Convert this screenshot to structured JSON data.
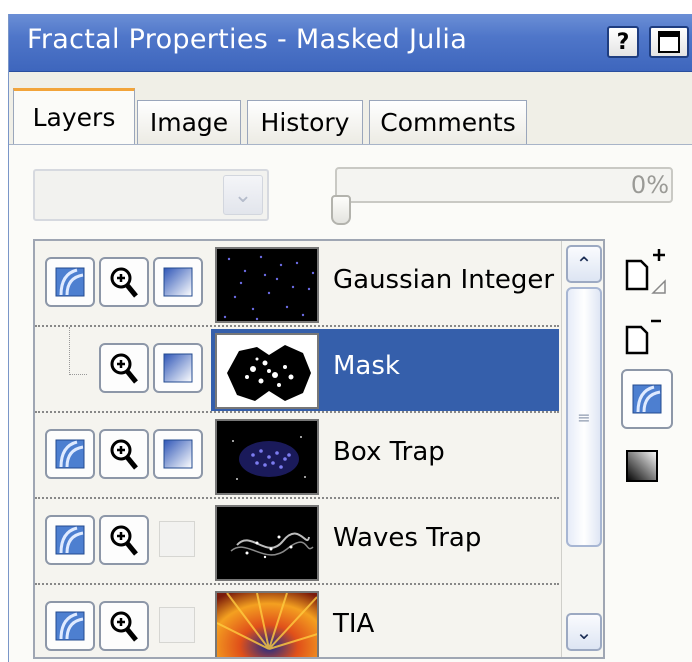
{
  "window": {
    "title": "Fractal Properties - Masked Julia",
    "help_label": "?"
  },
  "tabs": [
    {
      "label": "Layers",
      "active": true
    },
    {
      "label": "Image",
      "active": false
    },
    {
      "label": "History",
      "active": false
    },
    {
      "label": "Comments",
      "active": false
    }
  ],
  "layers_tab": {
    "blend_mode": {
      "value": "",
      "enabled": false
    },
    "opacity": {
      "value_text": "0%",
      "value": 0
    }
  },
  "layers": [
    {
      "name": "Gaussian Integer",
      "selected": false,
      "is_mask": false
    },
    {
      "name": "Mask",
      "selected": true,
      "is_mask": true
    },
    {
      "name": "Box Trap",
      "selected": false,
      "is_mask": false
    },
    {
      "name": "Waves Trap",
      "selected": false,
      "is_mask": false
    },
    {
      "name": "TIA",
      "selected": false,
      "is_mask": false
    }
  ],
  "side_toolbar": [
    "add-layer-icon",
    "delete-layer-icon",
    "layer-mode-icon",
    "gradient-icon"
  ],
  "colors": {
    "titlebar": "#4f76c9",
    "selection": "#355fab",
    "tab_accent": "#f2a43a"
  }
}
